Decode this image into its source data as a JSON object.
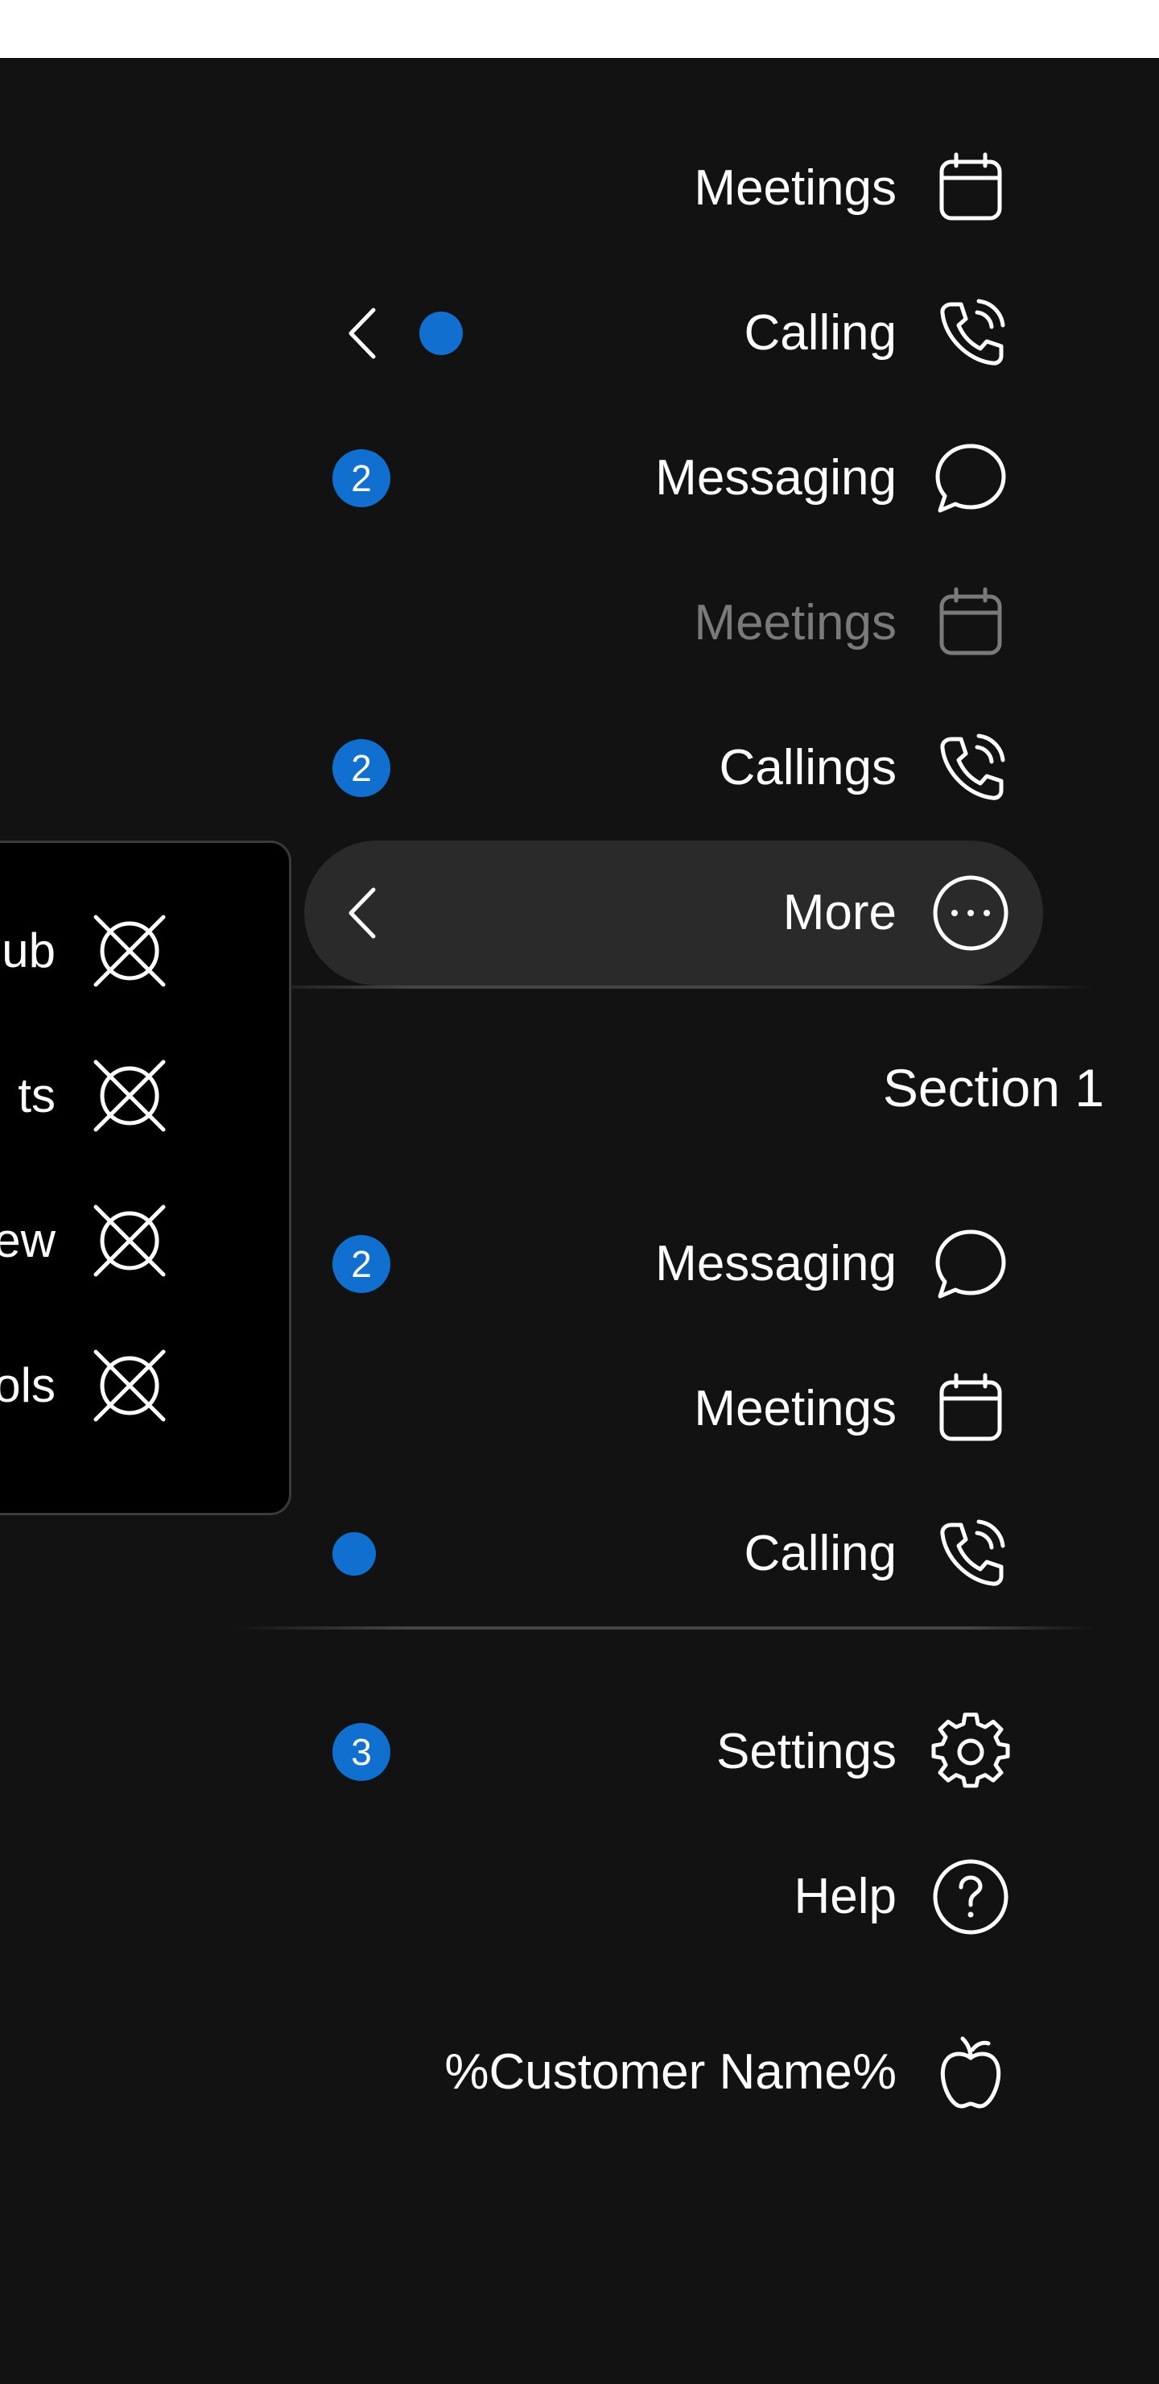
{
  "nav": {
    "items": [
      {
        "label": "Meetings",
        "icon": "calendar-icon"
      },
      {
        "label": "Calling",
        "icon": "phone-icon",
        "indicator": "dot"
      },
      {
        "label": "Messaging",
        "icon": "chat-icon",
        "badge": "2"
      },
      {
        "label": "Meetings",
        "icon": "calendar-icon",
        "state": "disabled"
      },
      {
        "label": "Callings",
        "icon": "phone-icon",
        "badge": "2"
      },
      {
        "label": "More",
        "icon": "more-icon",
        "state": "expanded"
      }
    ]
  },
  "section": {
    "title": "Section 1",
    "items": [
      {
        "label": "Messaging",
        "icon": "chat-icon",
        "badge": "2"
      },
      {
        "label": "Meetings",
        "icon": "calendar-icon"
      },
      {
        "label": "Calling",
        "icon": "phone-icon",
        "indicator": "dot"
      }
    ]
  },
  "footer": {
    "items": [
      {
        "label": "Settings",
        "icon": "gear-icon",
        "badge": "3"
      },
      {
        "label": "Help",
        "icon": "help-icon"
      },
      {
        "label": "%Customer Name%",
        "icon": "apple-icon"
      }
    ]
  },
  "popover": {
    "items": [
      {
        "label": "ub",
        "icon": "placeholder-x-icon"
      },
      {
        "label": "ts",
        "icon": "placeholder-x-icon"
      },
      {
        "label": "ew",
        "icon": "placeholder-x-icon"
      },
      {
        "label": "ols",
        "icon": "placeholder-x-icon"
      }
    ]
  },
  "colors": {
    "background": "#121212",
    "accent": "#1170cf",
    "pill": "#2a2a2a",
    "popover": "#000000",
    "text": "#ffffff",
    "muted": "#7a7a7a"
  }
}
